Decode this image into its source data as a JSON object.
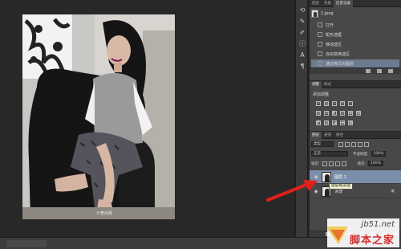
{
  "photo": {
    "credit": "©奢尚阁"
  },
  "history_panel": {
    "tabs": [
      "图层",
      "色板",
      "历史记录"
    ],
    "snapshot_label": "1.jpeg",
    "items": [
      {
        "label": "打开",
        "active": false
      },
      {
        "label": "矩形选框",
        "active": false
      },
      {
        "label": "移动选区",
        "active": false
      },
      {
        "label": "自由变换选区",
        "active": false
      },
      {
        "label": "通过拷贝的图层",
        "active": true
      }
    ]
  },
  "adjustments_panel": {
    "tabs": [
      "调整",
      "样式"
    ],
    "title": "添加调整"
  },
  "layers_panel": {
    "tabs": [
      "图层",
      "通道",
      "路径"
    ],
    "filter_label": "类型",
    "blend_mode": "正常",
    "opacity_label": "不透明度:",
    "opacity_value": "100%",
    "lock_label": "锁定:",
    "fill_label": "填充:",
    "fill_value": "100%",
    "layers": [
      {
        "name": "图层 1",
        "selected": true,
        "italic": false
      },
      {
        "name": "背景",
        "selected": false,
        "italic": true
      }
    ],
    "tooltip": "图层缩览图"
  },
  "watermark": {
    "domain": "jb51.net",
    "name": "脚本之家"
  },
  "colors": {
    "background": "#262626",
    "panel": "#4a4a4a",
    "selection": "#7b8ea9",
    "arrow": "#e0201a",
    "watermark_red": "#d0312d"
  }
}
